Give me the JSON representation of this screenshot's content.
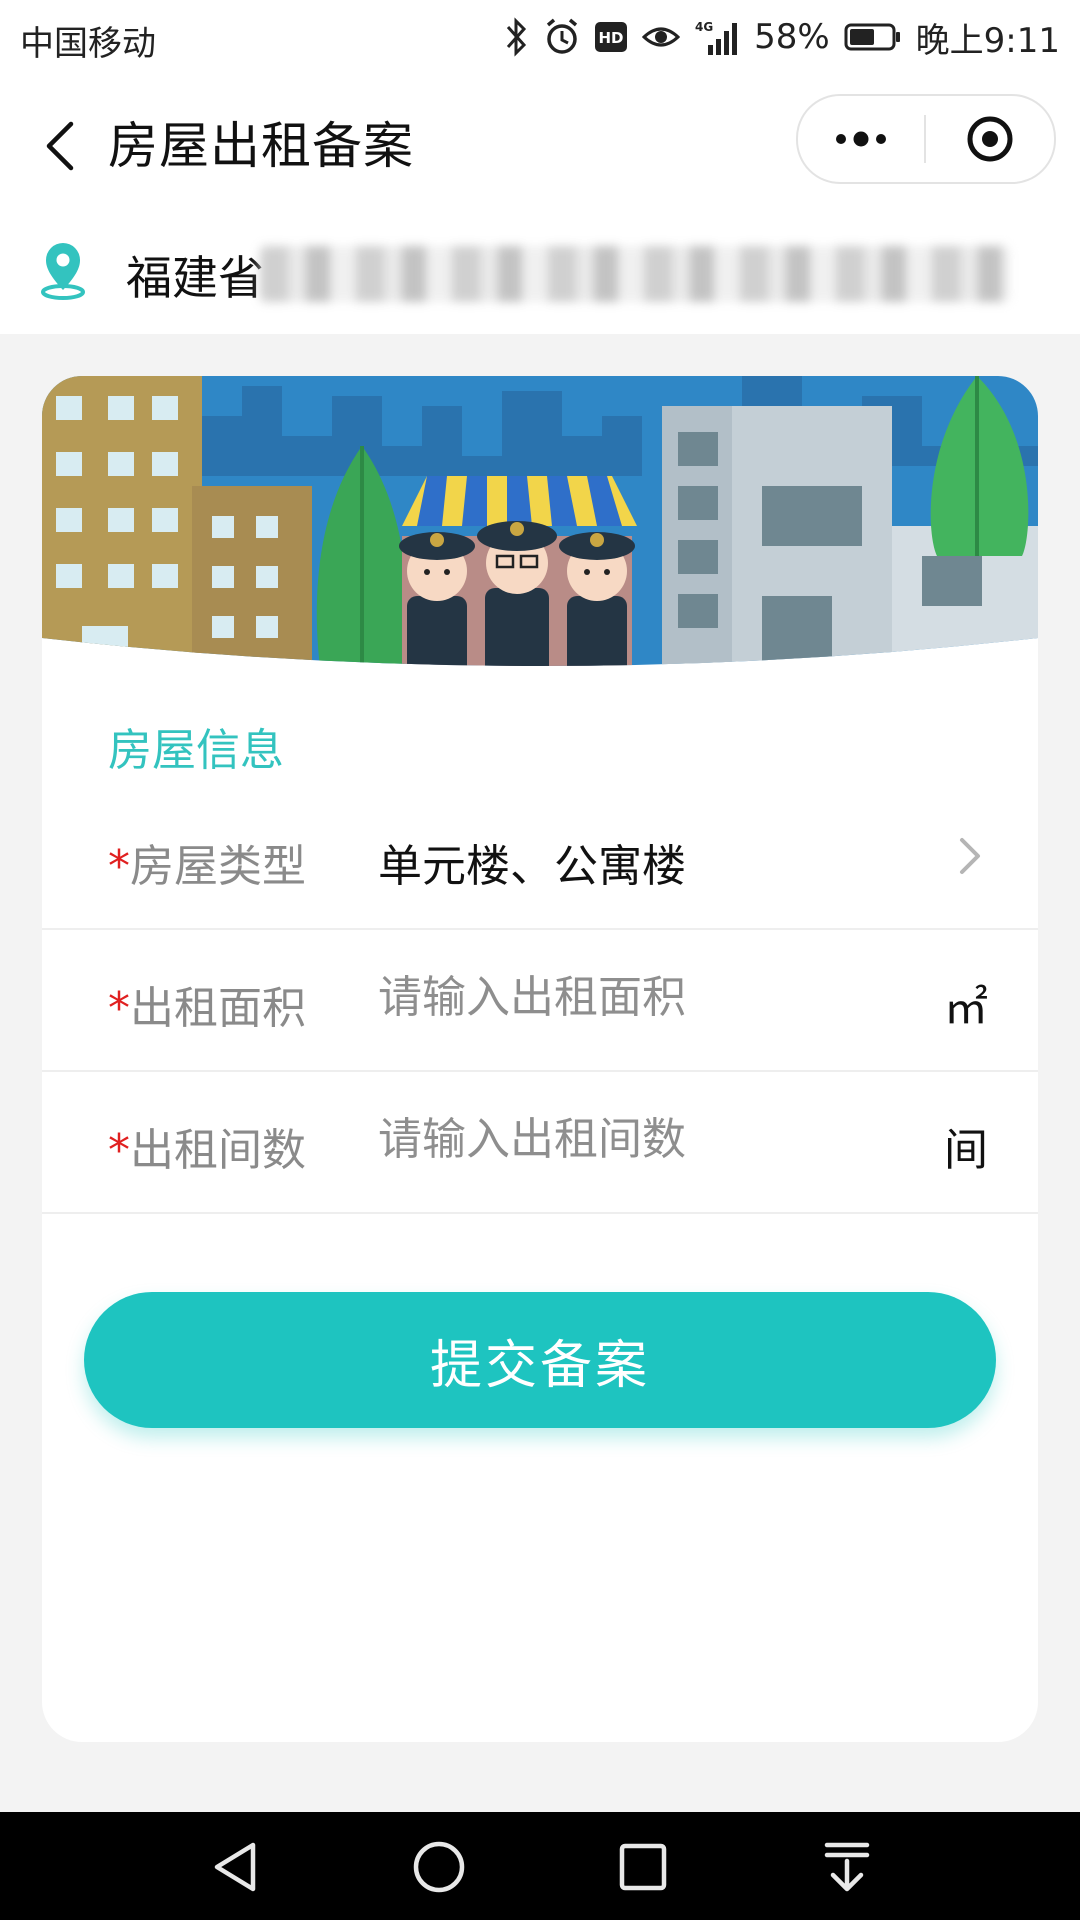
{
  "status_bar": {
    "carrier": "中国移动",
    "battery": "58%",
    "time": "晚上9:11",
    "icons": [
      "bluetooth-icon",
      "alarm-icon",
      "hd-icon",
      "eye-icon",
      "signal-4g-icon",
      "battery-icon"
    ]
  },
  "header": {
    "title": "房屋出租备案",
    "back_icon": "chevron-left-icon",
    "more_icon": "more-dots-icon",
    "close_icon": "target-close-icon"
  },
  "location": {
    "text": "福建省",
    "icon": "location-pin-icon"
  },
  "section": {
    "title": "房屋信息"
  },
  "form": {
    "rows": [
      {
        "required": "*",
        "label": "房屋类型",
        "value": "单元楼、公寓楼"
      },
      {
        "required": "*",
        "label": "出租面积",
        "placeholder": "请输入出租面积",
        "unit": "㎡"
      },
      {
        "required": "*",
        "label": "出租间数",
        "placeholder": "请输入出租间数",
        "unit": "间"
      }
    ]
  },
  "submit": {
    "label": "提交备案"
  },
  "colors": {
    "accent": "#1ec4c0",
    "section_title": "#33c3bf",
    "required": "#e02020"
  },
  "nav_bar": {
    "icons": [
      "back-triangle-icon",
      "home-circle-icon",
      "recents-square-icon",
      "notification-pull-icon"
    ]
  }
}
